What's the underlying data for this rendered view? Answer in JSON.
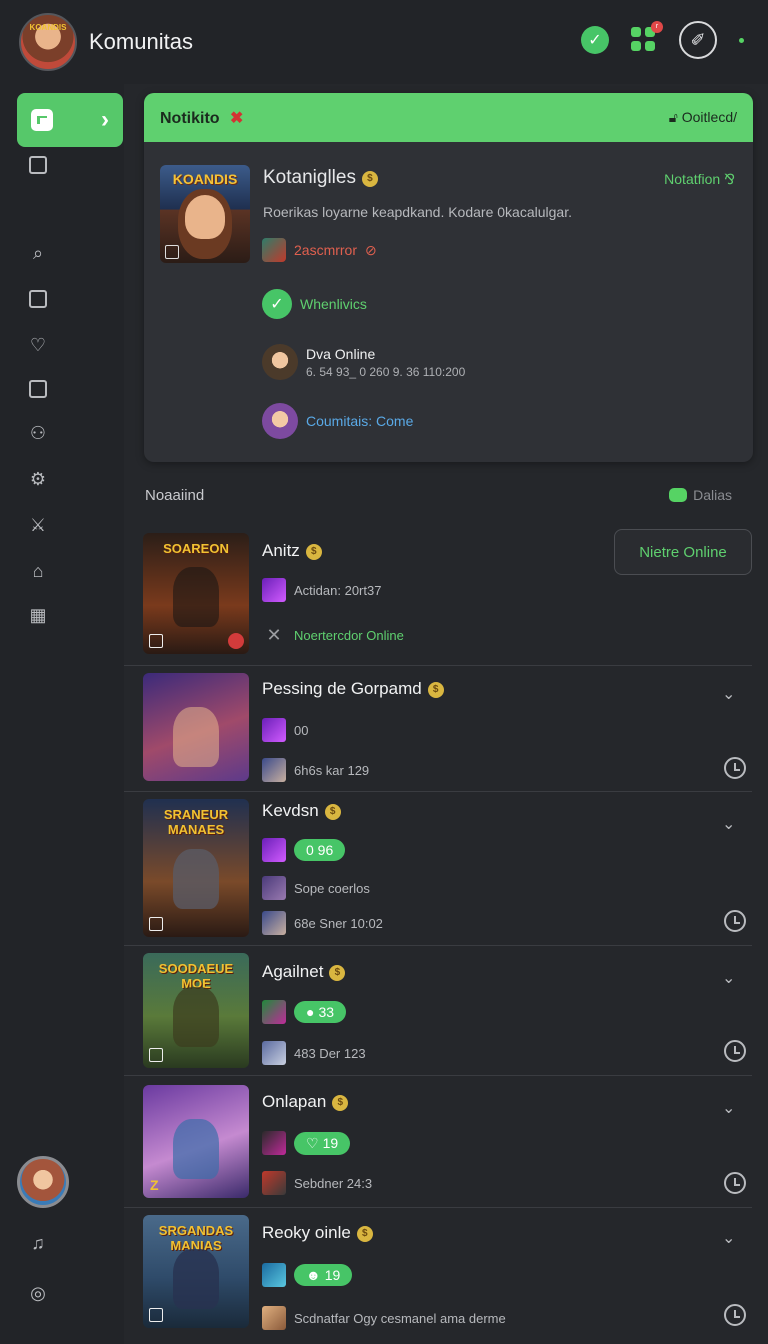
{
  "app": {
    "title": "Komunitas",
    "avatar_label": "KOANDIS"
  },
  "topbar": {
    "notification_count": "r"
  },
  "notification": {
    "header_title": "Notikito",
    "header_action": "Ooitlecd/",
    "cover_title": "KOANDIS",
    "name": "Kotaniglles",
    "side_link": "Notatfion ⅋",
    "description": "Roerikas loyarne keapdkand. Kodare 0kacalulgar.",
    "row1_text": "2ascmrror",
    "row2_text": "Whenlivics",
    "row3_name": "Dva Online",
    "row3_sub": "6. 54 93_ 0  260 9.  36 110:200",
    "row4_text": "Coumitais: Come"
  },
  "section": {
    "title": "Noaaiind",
    "link": "Dalias"
  },
  "items": [
    {
      "thumb_title": "SOAREON",
      "title": "Anitz",
      "row1": "Actidan: 20rt37",
      "row2": "Noertercdor Online",
      "button": "Nietre Online",
      "thumb_color": "#3a2a1e"
    },
    {
      "thumb_title": "",
      "title": "Pessing de Gorpamd",
      "row1": "00",
      "row2": "6h6s kar 129",
      "thumb_color": "#5d3a8a"
    },
    {
      "thumb_title": "SRANEUR MANAES",
      "title": "Kevdsn",
      "pill": "0 96",
      "row1": "Sope coerlos",
      "row2": "68e Sner 10:02",
      "thumb_color": "#2a2f4a"
    },
    {
      "thumb_title": "SOODAEUE MOE",
      "title": "Agailnet",
      "pill": "33",
      "row2": "483 Der 123",
      "thumb_color": "#3f5a3a"
    },
    {
      "thumb_title": "",
      "title": "Onlapan",
      "pill": "19",
      "row2": "Sebdner 24:3",
      "thumb_color": "#6a3a9a"
    },
    {
      "thumb_title": "SRGANDAS MANIAS",
      "title": "Reoky oinle",
      "pill": "19",
      "row2": "Scdnatfar Ogy cesmanel ama derme",
      "thumb_color": "#2f4b6a"
    }
  ],
  "colors": {
    "accent_green": "#5fd06f",
    "background": "#25272b",
    "sidebar": "#222428",
    "card": "#2f3136"
  },
  "icons": {
    "top": [
      "check-icon",
      "apps-grid-icon",
      "compose-icon",
      "status-dot-icon"
    ],
    "sidebar": [
      "files-icon",
      "search-icon",
      "wallet-icon",
      "heart-icon",
      "gallery-icon",
      "user-icon",
      "gear-icon",
      "sword-icon",
      "folder-icon",
      "calendar-icon",
      "music-icon",
      "compass-icon"
    ]
  }
}
